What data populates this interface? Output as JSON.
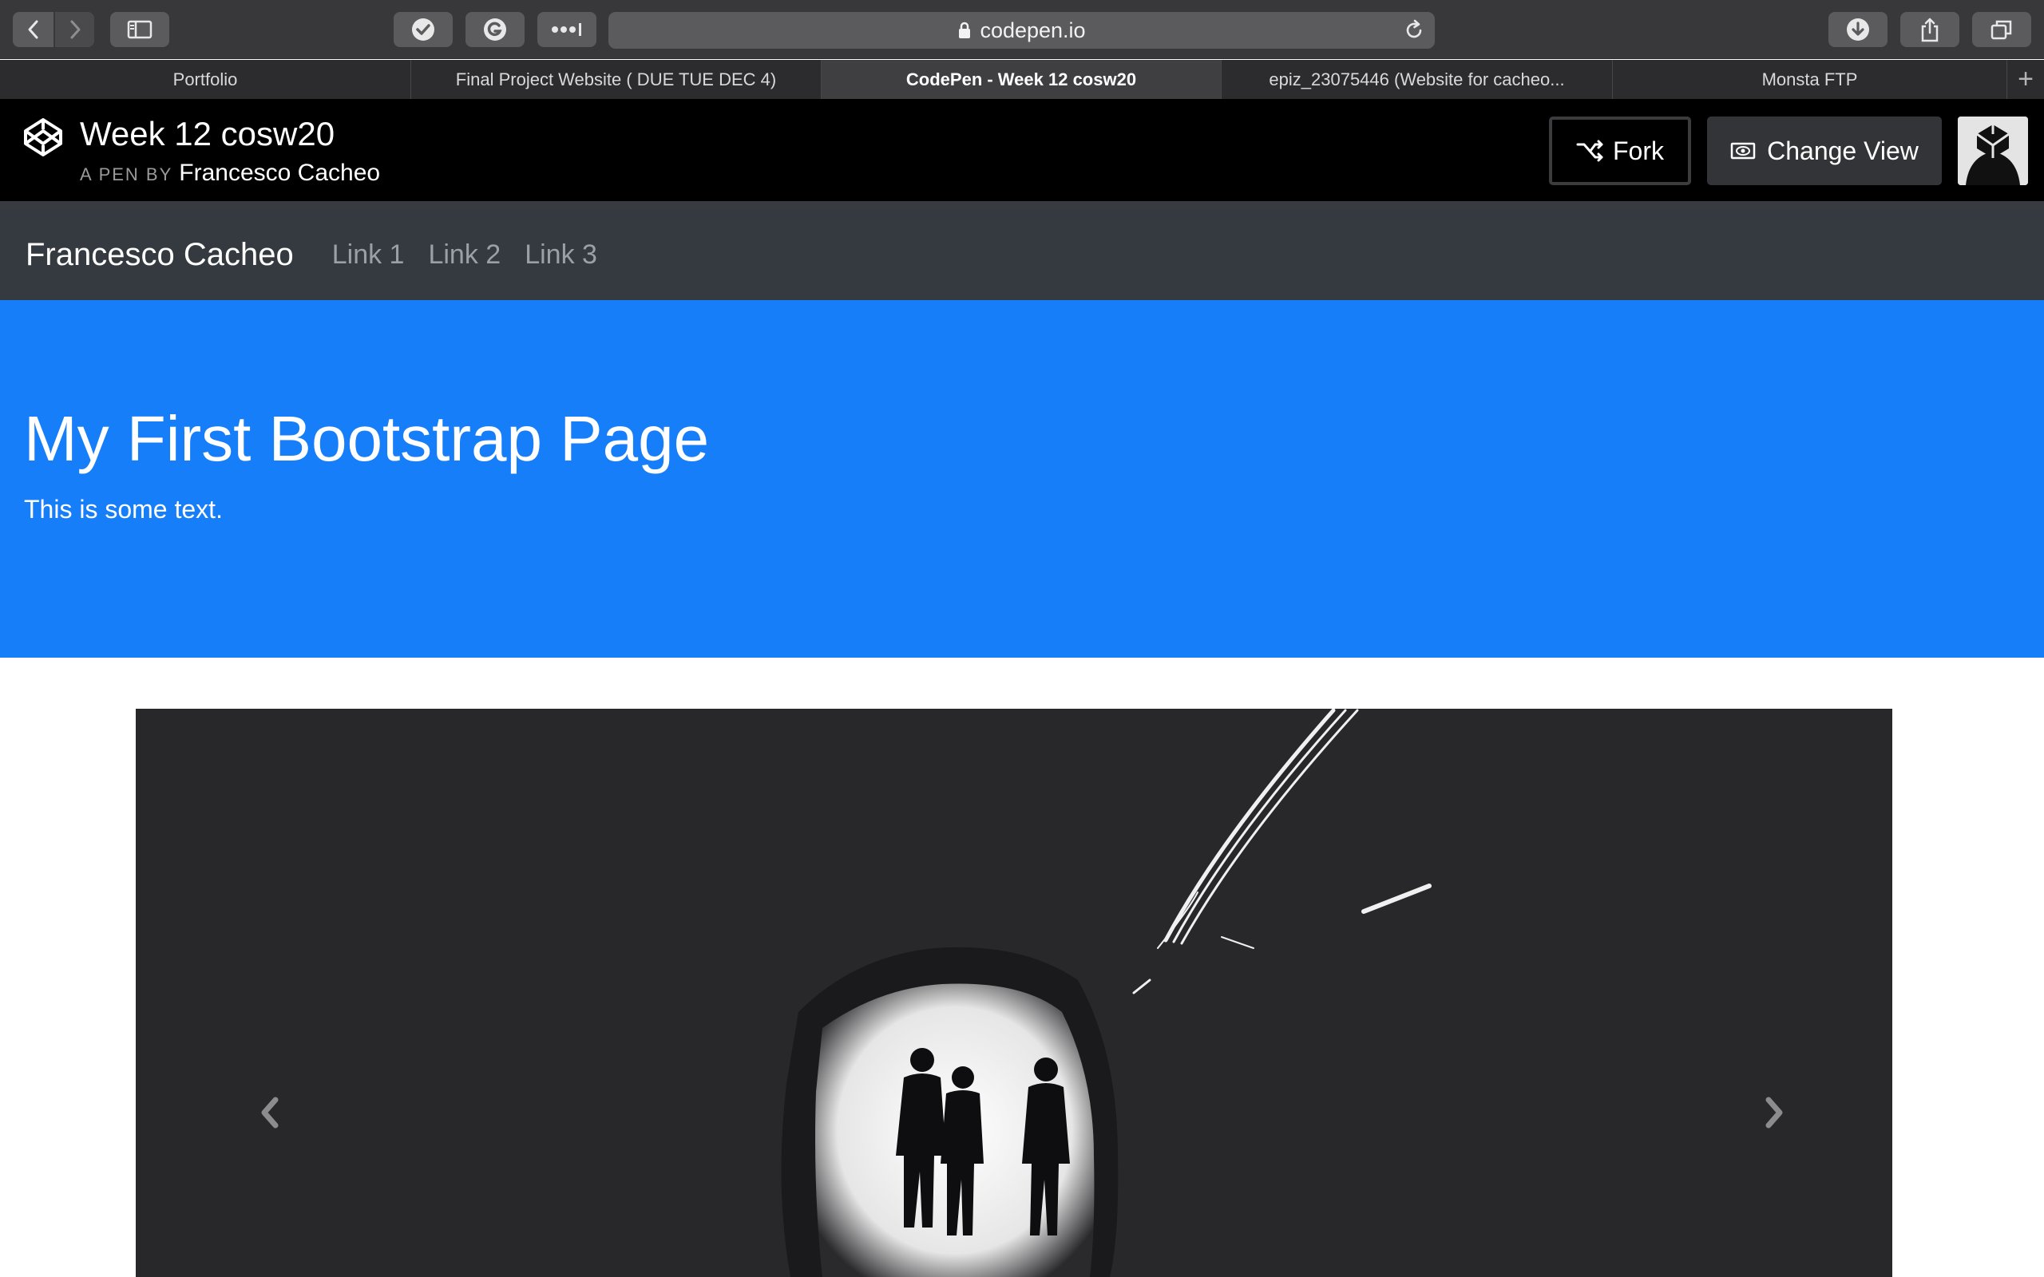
{
  "browser": {
    "url": "codepen.io",
    "tabs": [
      {
        "label": "Portfolio",
        "active": false
      },
      {
        "label": "Final Project Website ( DUE TUE DEC 4)",
        "active": false
      },
      {
        "label": "CodePen - Week 12 cosw20",
        "active": true
      },
      {
        "label": "epiz_23075446 (Website for cacheo...",
        "active": false
      },
      {
        "label": "Monsta FTP",
        "active": false
      }
    ],
    "icons": [
      "back-icon",
      "forward-icon",
      "sidebar-icon",
      "check-icon",
      "grammarly-icon",
      "password-icon",
      "lock-icon",
      "reload-icon",
      "download-icon",
      "share-icon",
      "tabs-icon",
      "new-tab-icon"
    ]
  },
  "codepen": {
    "title": "Week 12 cosw20",
    "subtitle_prefix": "A PEN BY",
    "author": "Francesco Cacheo",
    "fork_label": "Fork",
    "change_view_label": "Change View"
  },
  "navbar": {
    "brand": "Francesco Cacheo",
    "links": [
      "Link 1",
      "Link 2",
      "Link 3"
    ]
  },
  "jumbotron": {
    "heading": "My First Bootstrap Page",
    "text": "This is some text."
  },
  "colors": {
    "jumbotron_bg": "#177efa",
    "navbar_bg": "#343a40",
    "codepen_header_bg": "#000000",
    "carousel_bg": "#28272a"
  }
}
